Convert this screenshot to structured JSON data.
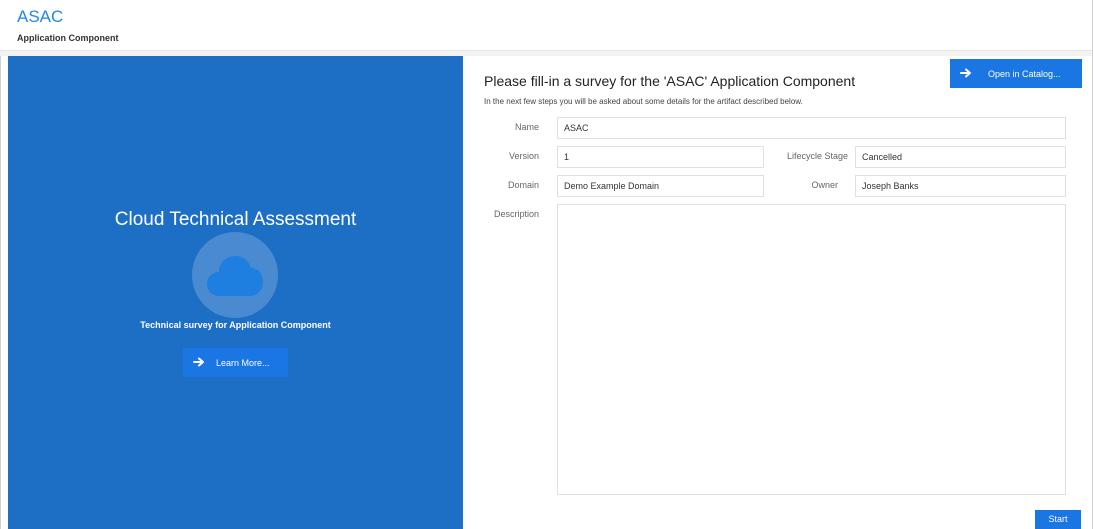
{
  "header": {
    "title": "ASAC",
    "subtitle": "Application Component"
  },
  "left_panel": {
    "title": "Cloud Technical Assessment",
    "icon": "cloud-icon",
    "subtitle": "Technical survey for Application Component",
    "learn_more_label": "Learn More...",
    "background_color": "#1d6fc5"
  },
  "survey": {
    "open_catalog_label": "Open in Catalog...",
    "heading": "Please fill-in a survey for the 'ASAC' Application Component",
    "intro": "In the next few steps you will be asked about some details for the artifact described below.",
    "fields": {
      "name": {
        "label": "Name",
        "value": "ASAC"
      },
      "version": {
        "label": "Version",
        "value": "1"
      },
      "lifecycle_stage": {
        "label": "Lifecycle Stage",
        "value": "Cancelled"
      },
      "domain": {
        "label": "Domain",
        "value": "Demo Example Domain"
      },
      "owner": {
        "label": "Owner",
        "value": "Joseph Banks"
      },
      "description": {
        "label": "Description",
        "value": ""
      }
    },
    "start_label": "Start"
  },
  "colors": {
    "accent": "#1976e3",
    "title_blue": "#1e88e5"
  }
}
